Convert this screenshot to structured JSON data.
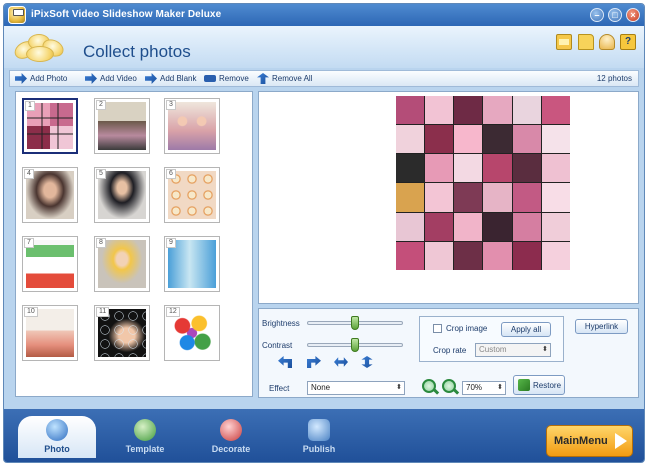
{
  "window": {
    "title": "iPixSoft Video Slideshow Maker Deluxe"
  },
  "header": {
    "title": "Collect photos"
  },
  "toolbar": {
    "add_photo": "Add Photo",
    "add_video": "Add Video",
    "add_blank": "Add Blank",
    "remove": "Remove",
    "remove_all": "Remove All",
    "photo_count": "12 photos"
  },
  "thumbnails": {
    "items": [
      {
        "num": "1"
      },
      {
        "num": "2"
      },
      {
        "num": "3"
      },
      {
        "num": "4"
      },
      {
        "num": "5"
      },
      {
        "num": "6"
      },
      {
        "num": "7"
      },
      {
        "num": "8"
      },
      {
        "num": "9"
      },
      {
        "num": "10"
      },
      {
        "num": "11"
      },
      {
        "num": "12"
      }
    ]
  },
  "controls": {
    "brightness_label": "Brightness",
    "contrast_label": "Contrast",
    "brightness_value": 0.5,
    "contrast_value": 0.5,
    "effect_label": "Effect",
    "effect_value": "None",
    "crop_image_label": "Crop image",
    "apply_all": "Apply all",
    "crop_rate_label": "Crop rate",
    "crop_rate_value": "Custom",
    "hyperlink": "Hyperlink",
    "zoom_value": "70%",
    "restore": "Restore"
  },
  "nav": {
    "tabs": [
      {
        "label": "Photo"
      },
      {
        "label": "Template"
      },
      {
        "label": "Decorate"
      },
      {
        "label": "Publish"
      }
    ],
    "main_menu": "MainMenu"
  }
}
